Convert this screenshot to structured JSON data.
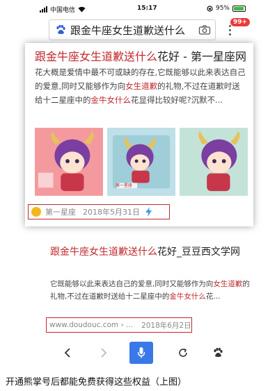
{
  "status_bar": {
    "carrier": "中国电信",
    "time": "15:17",
    "battery": "95%",
    "battery_level": 0.95
  },
  "search": {
    "query": "跟金牛座女生道歉送什么",
    "badge": "99+"
  },
  "result1": {
    "title_highlight": "跟金牛座女生道歉送什么",
    "title_rest": "花好 - 第一星座网",
    "desc_parts": [
      {
        "text": "花大概是爱情中最不可或缺的存在,它既能够以此来表达自己的爱意,同时又能够作为向",
        "hl": false
      },
      {
        "text": "女生道歉",
        "hl": true
      },
      {
        "text": "的礼物,不过在道歉时送给十二星座中的",
        "hl": false
      },
      {
        "text": "金牛女什么",
        "hl": true
      },
      {
        "text": "花显得比较好呢?沉默不...",
        "hl": false
      }
    ],
    "source": "第一星座",
    "date": "2018年5月31日",
    "thumb_caption": "第一星座"
  },
  "result2": {
    "title_highlight": "跟金牛座女生道歉送什么",
    "title_rest": "花好_豆豆西文学网",
    "desc_parts": [
      {
        "text": "它既能够以此来表达自己的爱意,同时又能够作为向",
        "hl": false
      },
      {
        "text": "女生道歉",
        "hl": true
      },
      {
        "text": "的礼物,不过在道歉时送给十二星座中的",
        "hl": false
      },
      {
        "text": "金牛女什么",
        "hl": true
      },
      {
        "text": "花...",
        "hl": false
      }
    ],
    "url": "www.doudouc.com › ...",
    "date": "2018年6月2日"
  },
  "caption": "开通熊掌号后都能免费获得这些权益（上图）",
  "colors": {
    "highlight": "#c0282d",
    "mic_button": "#3a78e8"
  }
}
